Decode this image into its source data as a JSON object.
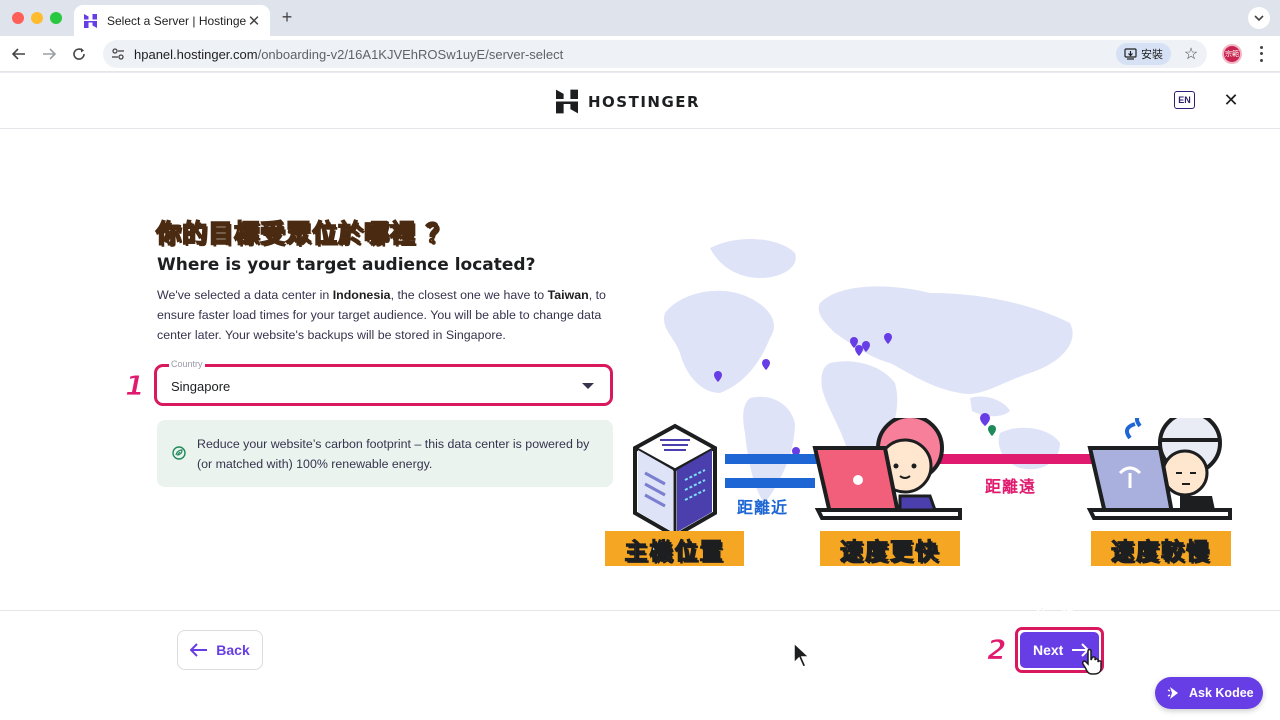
{
  "browser": {
    "tab_title": "Select a Server | Hostinger",
    "tab_close": "✕",
    "new_tab": "+",
    "url_host": "hpanel.hostinger.com",
    "url_path": "/onboarding-v2/16A1KJVEhROSw1uyE/server-select",
    "install_label": "安裝",
    "profile_initials": "宗範"
  },
  "header": {
    "brand": "HOSTINGER",
    "language": "EN",
    "close": "✕"
  },
  "main": {
    "annotation_title": "你的目標受眾位於哪裡 ？",
    "title": "Where is your target audience located?",
    "desc_part1": "We've selected a data center in ",
    "desc_bold1": "Indonesia",
    "desc_part2": ", the closest one we have to ",
    "desc_bold2": "Taiwan",
    "desc_part3": ", to ensure faster load times for your target audience. You will be able to change data center later. Your website's backups will be stored in Singapore.",
    "country_label": "Country",
    "country_value": "Singapore",
    "step1": "1",
    "eco_text": "Reduce your website’s carbon footprint – this data center is powered by (or matched with) 100% renewable energy."
  },
  "illustration": {
    "near_label": "距離近",
    "far_label": "距離遠",
    "tag_server": "主機位置",
    "tag_fast": "速度更快",
    "tag_slow": "速度較慢"
  },
  "footer": {
    "back_label": "Back",
    "next_hint": "下一步",
    "step2": "2",
    "next_label": "Next",
    "kodee_label": "Ask Kodee"
  },
  "colors": {
    "brand_purple": "#673de6",
    "annotation_pink": "#d9195e",
    "tag_orange": "#f5a623",
    "eco_bg": "#eaf3ee"
  }
}
